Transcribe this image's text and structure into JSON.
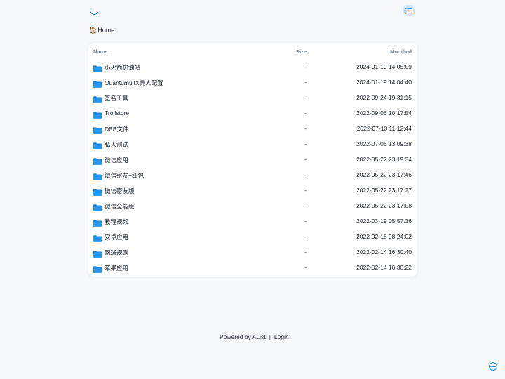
{
  "header": {
    "loading_icon": "spinner-icon",
    "layout_icon": "list-icon"
  },
  "breadcrumb": {
    "home_label": "Home",
    "home_icon": "house-emoji"
  },
  "table": {
    "columns": {
      "name": "Name",
      "size": "Size",
      "modified": "Modified"
    },
    "rows": [
      {
        "name": "小火箭加油站",
        "size": "-",
        "modified": "2024-01-19 14:05:09"
      },
      {
        "name": "QuantumultX懒人配置",
        "size": "-",
        "modified": "2024-01-19 14:04:40"
      },
      {
        "name": "签名工具",
        "size": "-",
        "modified": "2022-09-24 19:31:15"
      },
      {
        "name": "Trollstore",
        "size": "-",
        "modified": "2022-09-06 10:17:54"
      },
      {
        "name": "DEB文件",
        "size": "-",
        "modified": "2022-07-13 11:12:44"
      },
      {
        "name": "私人测试",
        "size": "-",
        "modified": "2022-07-06 13:09:38"
      },
      {
        "name": "微信应用",
        "size": "-",
        "modified": "2022-05-22 23:19:34"
      },
      {
        "name": "微信密友+红包",
        "size": "-",
        "modified": "2022-05-22 23:17:46"
      },
      {
        "name": "微信密友版",
        "size": "-",
        "modified": "2022-05-22 23:17:27"
      },
      {
        "name": "微信全能版",
        "size": "-",
        "modified": "2022-05-22 23:17:08"
      },
      {
        "name": "教程视频",
        "size": "-",
        "modified": "2022-03-19 05:57:36"
      },
      {
        "name": "安卓应用",
        "size": "-",
        "modified": "2022-02-18 08:24:02"
      },
      {
        "name": "网球规则",
        "size": "-",
        "modified": "2022-02-14 16:30:40"
      },
      {
        "name": "苹果应用",
        "size": "-",
        "modified": "2022-02-14 16:30:22"
      }
    ]
  },
  "footer": {
    "powered_by": "Powered by AList",
    "separator": "|",
    "login": "Login"
  },
  "colors": {
    "accent": "#1890ff",
    "folder": "#1e88e5",
    "background": "#f7f8fa"
  }
}
